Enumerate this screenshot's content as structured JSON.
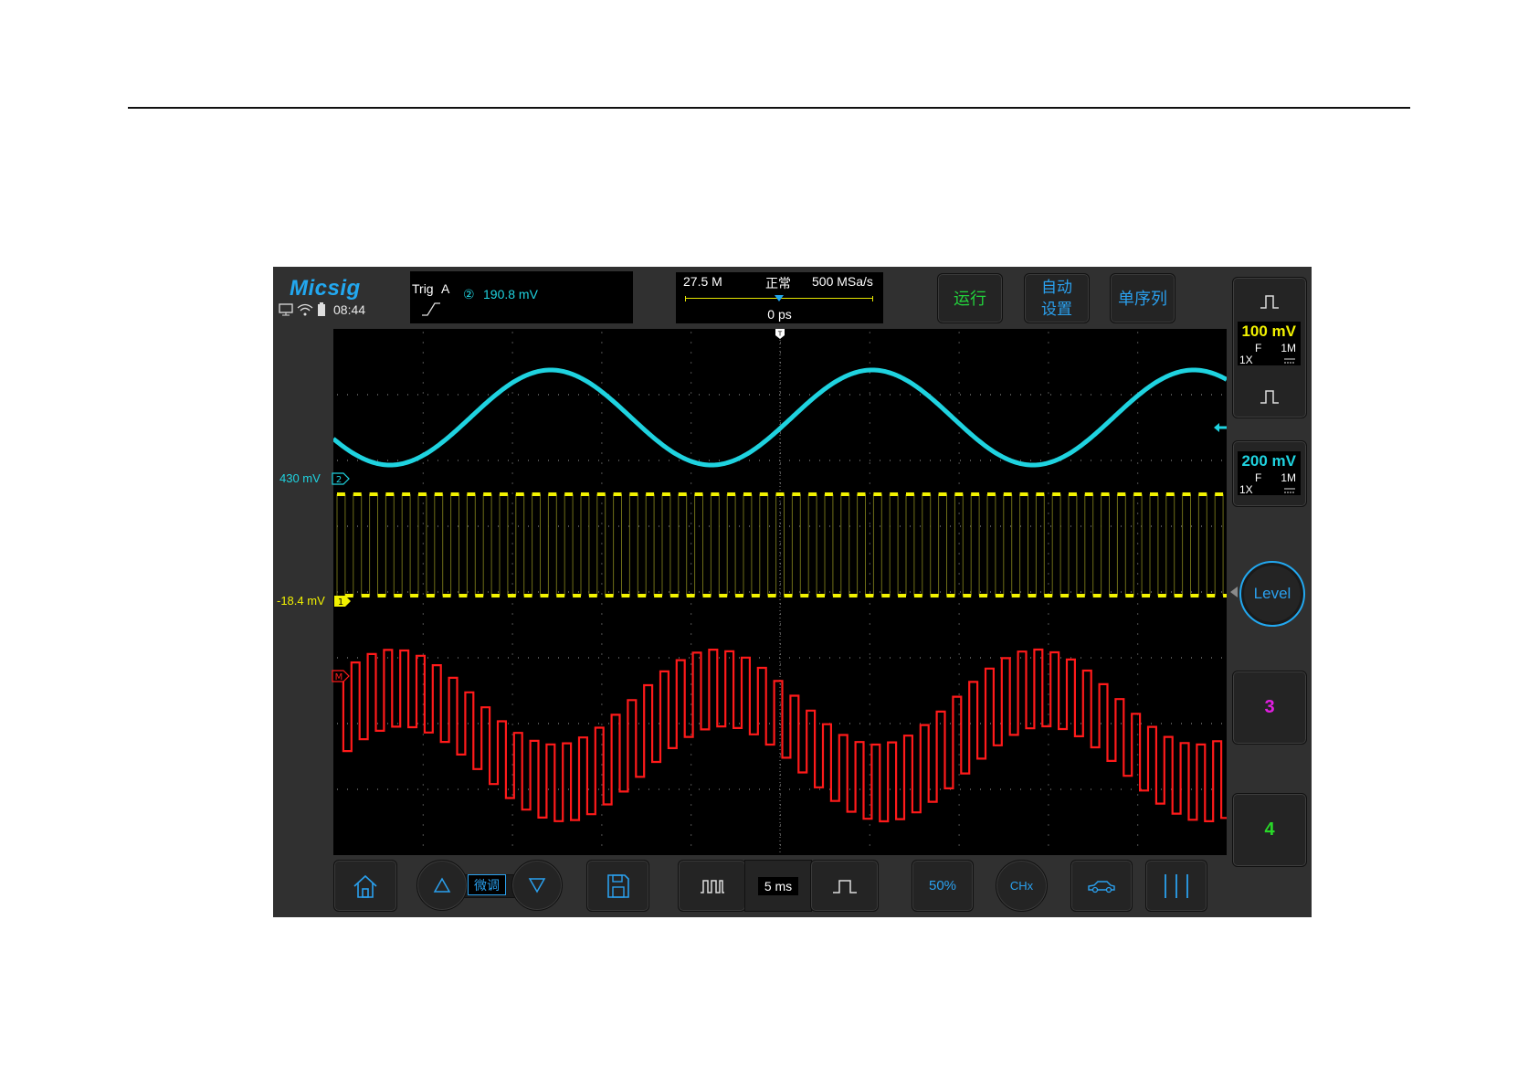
{
  "app": {
    "logo": "Micsig",
    "clock": "08:44"
  },
  "trigger": {
    "label": "Trig",
    "mode": "A",
    "source": "②",
    "level": "190.8  mV"
  },
  "timebase_header": {
    "memory": "27.5 M",
    "mode": "正常",
    "sample_rate": "500 MSa/s",
    "delay": "0 ps"
  },
  "buttons": {
    "run": "运行",
    "auto_set_line1": "自动",
    "auto_set_line2": "设置",
    "single_seq": "单序列",
    "fine": "微调",
    "timebase": "5 ms",
    "fifty": "50%",
    "chx": "CHx",
    "level": "Level",
    "ch3": "3",
    "ch4": "4"
  },
  "channels": {
    "ch1": {
      "scale": "100 mV",
      "coupling": "F",
      "impedance": "1M",
      "probe": "1X",
      "offset_label": "-18.4 mV",
      "marker": "1",
      "color": "#f2f200"
    },
    "ch2": {
      "scale": "200 mV",
      "coupling": "F",
      "impedance": "1M",
      "probe": "1X",
      "offset_label": "430 mV",
      "marker": "2",
      "color": "#1fd3e0"
    },
    "math": {
      "marker": "M",
      "color": "#ff1a1a"
    }
  },
  "colors": {
    "ch3": "#e21ee2",
    "ch4": "#28d828",
    "accent": "#22a8f0"
  }
}
